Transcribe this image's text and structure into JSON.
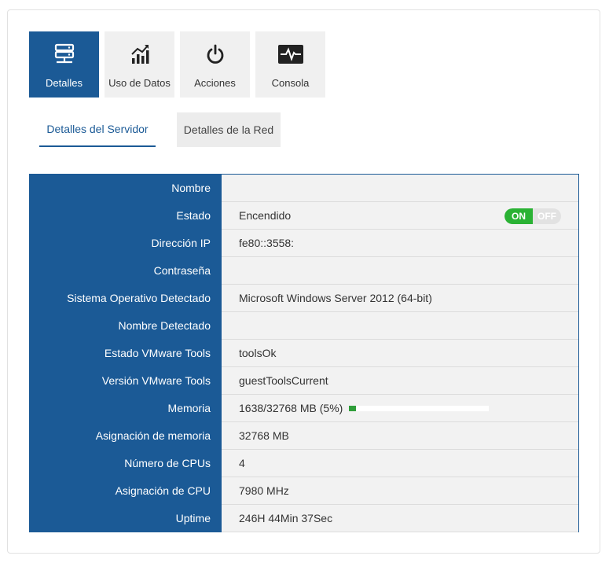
{
  "tiles": [
    {
      "label": "Detalles",
      "icon": "server-icon",
      "active": true
    },
    {
      "label": "Uso de Datos",
      "icon": "bar-chart-icon",
      "active": false
    },
    {
      "label": "Acciones",
      "icon": "power-icon",
      "active": false
    },
    {
      "label": "Consola",
      "icon": "pulse-monitor-icon",
      "active": false
    }
  ],
  "subtabs": {
    "server": "Detalles del Servidor",
    "network": "Detalles de la Red"
  },
  "details": {
    "rows": [
      {
        "key": "Nombre",
        "value": ""
      },
      {
        "key": "Estado",
        "value": "Encendido"
      },
      {
        "key": "Dirección IP",
        "value": "fe80::3558:"
      },
      {
        "key": "Contraseña",
        "value": ""
      },
      {
        "key": "Sistema Operativo Detectado",
        "value": "Microsoft Windows Server 2012 (64-bit)"
      },
      {
        "key": "Nombre Detectado",
        "value": ""
      },
      {
        "key": "Estado VMware Tools",
        "value": "toolsOk"
      },
      {
        "key": "Versión VMware Tools",
        "value": "guestToolsCurrent"
      },
      {
        "key": "Memoria",
        "value": "1638/32768 MB (5%)"
      },
      {
        "key": "Asignación de memoria",
        "value": "32768 MB"
      },
      {
        "key": "Número de CPUs",
        "value": "4"
      },
      {
        "key": "Asignación de CPU",
        "value": "7980 MHz"
      },
      {
        "key": "Uptime",
        "value": "246H 44Min 37Sec"
      }
    ],
    "toggle": {
      "on_label": "ON",
      "off_label": "OFF",
      "state": "on"
    },
    "memory_fraction": 0.05
  },
  "colors": {
    "primary": "#1b5a96",
    "toggle_on": "#2ab234",
    "memory_bar": "#2f9e3a"
  }
}
